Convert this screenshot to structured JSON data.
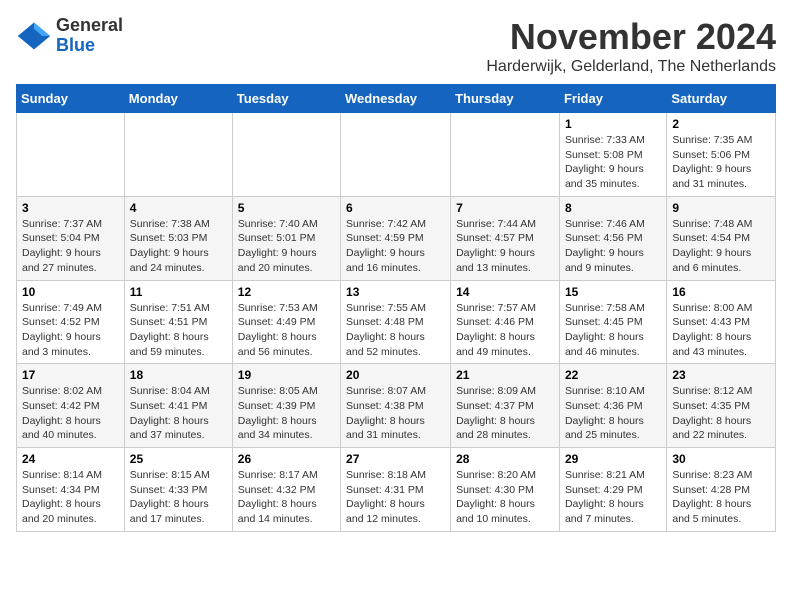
{
  "logo": {
    "general": "General",
    "blue": "Blue"
  },
  "header": {
    "month": "November 2024",
    "location": "Harderwijk, Gelderland, The Netherlands"
  },
  "weekdays": [
    "Sunday",
    "Monday",
    "Tuesday",
    "Wednesday",
    "Thursday",
    "Friday",
    "Saturday"
  ],
  "weeks": [
    [
      {
        "day": "",
        "info": ""
      },
      {
        "day": "",
        "info": ""
      },
      {
        "day": "",
        "info": ""
      },
      {
        "day": "",
        "info": ""
      },
      {
        "day": "",
        "info": ""
      },
      {
        "day": "1",
        "info": "Sunrise: 7:33 AM\nSunset: 5:08 PM\nDaylight: 9 hours and 35 minutes."
      },
      {
        "day": "2",
        "info": "Sunrise: 7:35 AM\nSunset: 5:06 PM\nDaylight: 9 hours and 31 minutes."
      }
    ],
    [
      {
        "day": "3",
        "info": "Sunrise: 7:37 AM\nSunset: 5:04 PM\nDaylight: 9 hours and 27 minutes."
      },
      {
        "day": "4",
        "info": "Sunrise: 7:38 AM\nSunset: 5:03 PM\nDaylight: 9 hours and 24 minutes."
      },
      {
        "day": "5",
        "info": "Sunrise: 7:40 AM\nSunset: 5:01 PM\nDaylight: 9 hours and 20 minutes."
      },
      {
        "day": "6",
        "info": "Sunrise: 7:42 AM\nSunset: 4:59 PM\nDaylight: 9 hours and 16 minutes."
      },
      {
        "day": "7",
        "info": "Sunrise: 7:44 AM\nSunset: 4:57 PM\nDaylight: 9 hours and 13 minutes."
      },
      {
        "day": "8",
        "info": "Sunrise: 7:46 AM\nSunset: 4:56 PM\nDaylight: 9 hours and 9 minutes."
      },
      {
        "day": "9",
        "info": "Sunrise: 7:48 AM\nSunset: 4:54 PM\nDaylight: 9 hours and 6 minutes."
      }
    ],
    [
      {
        "day": "10",
        "info": "Sunrise: 7:49 AM\nSunset: 4:52 PM\nDaylight: 9 hours and 3 minutes."
      },
      {
        "day": "11",
        "info": "Sunrise: 7:51 AM\nSunset: 4:51 PM\nDaylight: 8 hours and 59 minutes."
      },
      {
        "day": "12",
        "info": "Sunrise: 7:53 AM\nSunset: 4:49 PM\nDaylight: 8 hours and 56 minutes."
      },
      {
        "day": "13",
        "info": "Sunrise: 7:55 AM\nSunset: 4:48 PM\nDaylight: 8 hours and 52 minutes."
      },
      {
        "day": "14",
        "info": "Sunrise: 7:57 AM\nSunset: 4:46 PM\nDaylight: 8 hours and 49 minutes."
      },
      {
        "day": "15",
        "info": "Sunrise: 7:58 AM\nSunset: 4:45 PM\nDaylight: 8 hours and 46 minutes."
      },
      {
        "day": "16",
        "info": "Sunrise: 8:00 AM\nSunset: 4:43 PM\nDaylight: 8 hours and 43 minutes."
      }
    ],
    [
      {
        "day": "17",
        "info": "Sunrise: 8:02 AM\nSunset: 4:42 PM\nDaylight: 8 hours and 40 minutes."
      },
      {
        "day": "18",
        "info": "Sunrise: 8:04 AM\nSunset: 4:41 PM\nDaylight: 8 hours and 37 minutes."
      },
      {
        "day": "19",
        "info": "Sunrise: 8:05 AM\nSunset: 4:39 PM\nDaylight: 8 hours and 34 minutes."
      },
      {
        "day": "20",
        "info": "Sunrise: 8:07 AM\nSunset: 4:38 PM\nDaylight: 8 hours and 31 minutes."
      },
      {
        "day": "21",
        "info": "Sunrise: 8:09 AM\nSunset: 4:37 PM\nDaylight: 8 hours and 28 minutes."
      },
      {
        "day": "22",
        "info": "Sunrise: 8:10 AM\nSunset: 4:36 PM\nDaylight: 8 hours and 25 minutes."
      },
      {
        "day": "23",
        "info": "Sunrise: 8:12 AM\nSunset: 4:35 PM\nDaylight: 8 hours and 22 minutes."
      }
    ],
    [
      {
        "day": "24",
        "info": "Sunrise: 8:14 AM\nSunset: 4:34 PM\nDaylight: 8 hours and 20 minutes."
      },
      {
        "day": "25",
        "info": "Sunrise: 8:15 AM\nSunset: 4:33 PM\nDaylight: 8 hours and 17 minutes."
      },
      {
        "day": "26",
        "info": "Sunrise: 8:17 AM\nSunset: 4:32 PM\nDaylight: 8 hours and 14 minutes."
      },
      {
        "day": "27",
        "info": "Sunrise: 8:18 AM\nSunset: 4:31 PM\nDaylight: 8 hours and 12 minutes."
      },
      {
        "day": "28",
        "info": "Sunrise: 8:20 AM\nSunset: 4:30 PM\nDaylight: 8 hours and 10 minutes."
      },
      {
        "day": "29",
        "info": "Sunrise: 8:21 AM\nSunset: 4:29 PM\nDaylight: 8 hours and 7 minutes."
      },
      {
        "day": "30",
        "info": "Sunrise: 8:23 AM\nSunset: 4:28 PM\nDaylight: 8 hours and 5 minutes."
      }
    ]
  ]
}
